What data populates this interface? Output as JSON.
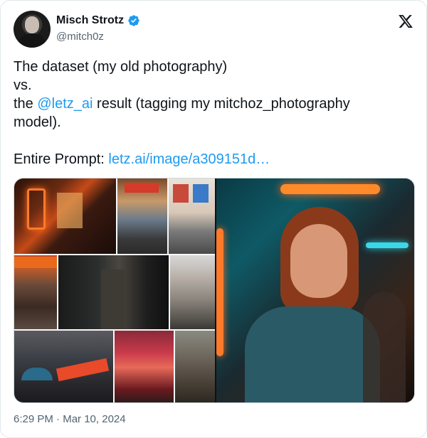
{
  "tweet": {
    "author": {
      "display_name": "Misch Strotz",
      "handle": "@mitch0z",
      "verified": true
    },
    "text_lines": {
      "line1": "The dataset (my old photography)",
      "line2": "vs.",
      "line3_prefix": "the ",
      "line3_mention": "@letz_ai",
      "line3_suffix": " result (tagging my mitchoz_photography",
      "line4": "model).",
      "prompt_label": "Entire Prompt: ",
      "prompt_link": "letz.ai/image/a309151d…"
    },
    "media": {
      "left_grid": [
        "storefront-neon-photo",
        "market-stall-photo",
        "poster-wall-photo",
        "crab-restaurant-photo",
        "alley-doorway-photo",
        "street-buildings-photo",
        "seven-eleven-street-photo",
        "red-shop-photo",
        "street-vendor-photo"
      ],
      "right_image": "ai-portrait-neon-photo"
    },
    "footer": {
      "time": "6:29 PM",
      "separator": " · ",
      "date": "Mar 10, 2024"
    }
  },
  "icons": {
    "verified": "verified-badge-icon",
    "platform": "x-logo-icon"
  },
  "colors": {
    "link": "#1d9bf0",
    "text": "#0f1419",
    "muted": "#536471",
    "border": "#e1e8ed"
  }
}
